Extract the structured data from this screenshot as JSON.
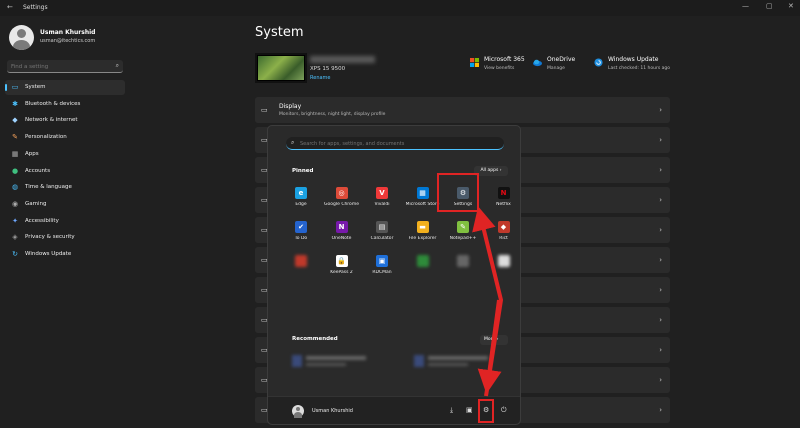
{
  "window": {
    "back": "←",
    "title": "Settings",
    "min": "—",
    "max": "▢",
    "close": "✕"
  },
  "user": {
    "name": "Usman Khurshid",
    "email": "usman@itechtics.com"
  },
  "search": {
    "placeholder": "Find a setting",
    "icon": "search-icon"
  },
  "nav": [
    {
      "label": "System",
      "icon": "system-icon",
      "glyph": "▭",
      "color": "#4cc2ff",
      "active": true
    },
    {
      "label": "Bluetooth & devices",
      "icon": "bluetooth-icon",
      "glyph": "✱",
      "color": "#4cc2ff"
    },
    {
      "label": "Network & internet",
      "icon": "wifi-icon",
      "glyph": "◆",
      "color": "#9fd3ff"
    },
    {
      "label": "Personalization",
      "icon": "brush-icon",
      "glyph": "✎",
      "color": "#f7a35c"
    },
    {
      "label": "Apps",
      "icon": "apps-icon",
      "glyph": "▦",
      "color": "#aaa"
    },
    {
      "label": "Accounts",
      "icon": "accounts-icon",
      "glyph": "●",
      "color": "#3fbf7f"
    },
    {
      "label": "Time & language",
      "icon": "globe-icon",
      "glyph": "◍",
      "color": "#4cc2ff"
    },
    {
      "label": "Gaming",
      "icon": "gamepad-icon",
      "glyph": "◉",
      "color": "#aaa"
    },
    {
      "label": "Accessibility",
      "icon": "accessibility-icon",
      "glyph": "✦",
      "color": "#6fa8ff"
    },
    {
      "label": "Privacy & security",
      "icon": "shield-icon",
      "glyph": "◈",
      "color": "#999"
    },
    {
      "label": "Windows Update",
      "icon": "update-icon",
      "glyph": "↻",
      "color": "#4cc2ff"
    }
  ],
  "page": {
    "title": "System"
  },
  "device": {
    "model": "XPS 15 9500",
    "rename": "Rename"
  },
  "quick_actions": [
    {
      "title": "Microsoft 365",
      "sub": "View benefits",
      "icon": "microsoft-365-icon"
    },
    {
      "title": "OneDrive",
      "sub": "Manage",
      "icon": "onedrive-icon"
    },
    {
      "title": "Windows Update",
      "sub": "Last checked: 11 hours ago",
      "icon": "windows-update-icon"
    }
  ],
  "rows": [
    {
      "title": "Display",
      "sub": "Monitors, brightness, night light, display profile",
      "icon": "display-icon"
    },
    {
      "icon": "sound-icon"
    },
    {
      "icon": "notifications-icon"
    },
    {
      "icon": "focus-icon"
    },
    {
      "icon": "power-icon"
    },
    {
      "icon": "storage-icon"
    },
    {
      "icon": "nearby-sharing-icon"
    },
    {
      "icon": "multitasking-icon"
    },
    {
      "icon": "activation-icon"
    },
    {
      "icon": "troubleshoot-icon"
    },
    {
      "icon": "recovery-icon"
    }
  ],
  "start_menu": {
    "search_placeholder": "Search for apps, settings, and documents",
    "pinned_label": "Pinned",
    "all_apps": "All apps  ›",
    "recommended_label": "Recommended",
    "more": "More  ›",
    "user_name": "Usman Khurshid",
    "pinned": [
      {
        "label": "Edge",
        "icon": "edge-icon",
        "color": "#1ba1e2",
        "glyph": "e"
      },
      {
        "label": "Google Chrome",
        "icon": "chrome-icon",
        "color": "#dd4b39",
        "glyph": "◎"
      },
      {
        "label": "Vivaldi",
        "icon": "vivaldi-icon",
        "color": "#ef3939",
        "glyph": "V"
      },
      {
        "label": "Microsoft Store",
        "icon": "store-icon",
        "color": "#0078d4",
        "glyph": "▦"
      },
      {
        "label": "Settings",
        "icon": "settings-gear-icon",
        "color": "#4a5a6a",
        "glyph": "⚙"
      },
      {
        "label": "Netflix",
        "icon": "netflix-icon",
        "color": "#111",
        "glyph": "N"
      },
      {
        "label": "To Do",
        "icon": "todo-icon",
        "color": "#2564cf",
        "glyph": "✔"
      },
      {
        "label": "OneNote",
        "icon": "onenote-icon",
        "color": "#7719aa",
        "glyph": "N"
      },
      {
        "label": "Calculator",
        "icon": "calculator-icon",
        "color": "#555",
        "glyph": "▤"
      },
      {
        "label": "File Explorer",
        "icon": "file-explorer-icon",
        "color": "#f2b01e",
        "glyph": "▬"
      },
      {
        "label": "Notepad++",
        "icon": "notepadpp-icon",
        "color": "#80c040",
        "glyph": "✎"
      },
      {
        "label": "Rict",
        "icon": "app-icon",
        "color": "#c0392b",
        "glyph": "◆"
      },
      {
        "label": "",
        "icon": "blurred-app-icon",
        "color": "#c0392b",
        "glyph": "",
        "blur": true
      },
      {
        "label": "KeePass 2",
        "icon": "keepass-icon",
        "color": "#fff",
        "glyph": "🔒"
      },
      {
        "label": "RDCMan",
        "icon": "rdcman-icon",
        "color": "#1e6fd9",
        "glyph": "▣"
      },
      {
        "label": "",
        "icon": "blurred-app-icon",
        "color": "#2e8b3a",
        "glyph": "",
        "blur": true
      },
      {
        "label": "",
        "icon": "blurred-app-icon",
        "color": "#666",
        "glyph": "",
        "blur": true
      },
      {
        "label": "",
        "icon": "blurred-app-icon",
        "color": "#ddd",
        "glyph": "",
        "blur": true
      }
    ],
    "footer_buttons": [
      {
        "icon": "downloads-icon",
        "glyph": "⤓"
      },
      {
        "icon": "gallery-icon",
        "glyph": "▣"
      },
      {
        "icon": "settings-icon",
        "glyph": "⚙"
      },
      {
        "icon": "power-icon",
        "glyph": "⏻"
      }
    ]
  },
  "annotation": {
    "color": "#e02424"
  }
}
